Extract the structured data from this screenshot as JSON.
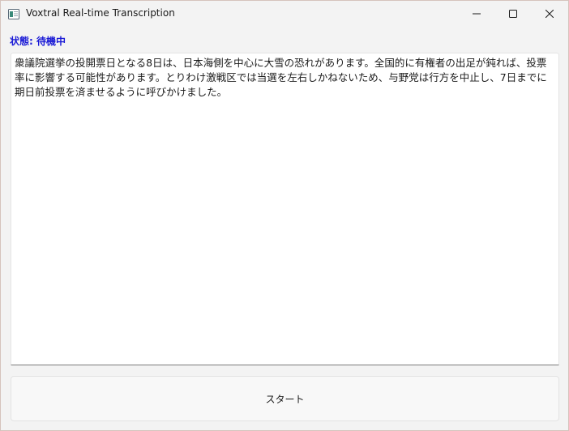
{
  "window": {
    "title": "Voxtral Real-time Transcription",
    "controls": {
      "minimize_icon": "minimize-icon",
      "maximize_icon": "maximize-icon",
      "close_icon": "close-icon"
    }
  },
  "status": {
    "label": "状態: 待機中",
    "color": "#1b1bd6"
  },
  "transcript": {
    "text": "衆議院選挙の投開票日となる8日は、日本海側を中心に大雪の恐れがあります。全国的に有権者の出足が鈍れば、投票率に影響する可能性があります。とりわけ激戦区では当選を左右しかねないため、与野党は行方を中止し、7日までに期日前投票を済ませるように呼びかけました。"
  },
  "actions": {
    "start_label": "スタート"
  }
}
